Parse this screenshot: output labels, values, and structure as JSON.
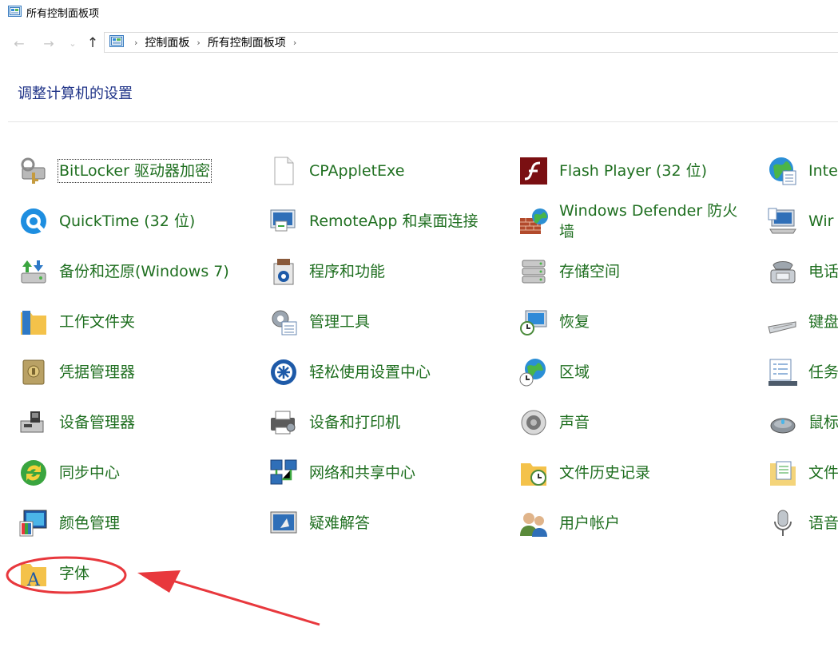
{
  "window": {
    "title": "所有控制面板项",
    "icon": "control-panel-icon"
  },
  "nav": {
    "back_icon": "←",
    "forward_icon": "→",
    "recent_icon": "⌄",
    "up_icon": "↑"
  },
  "breadcrumb": [
    "控制面板",
    "所有控制面板项"
  ],
  "heading": "调整计算机的设置",
  "items": [
    {
      "label": "BitLocker 驱动器加密",
      "icon": "bitlocker-icon"
    },
    {
      "label": "CPAppletExe",
      "icon": "file-icon"
    },
    {
      "label": "Flash Player (32 位)",
      "icon": "flash-icon"
    },
    {
      "label": "Inte",
      "icon": "internet-options-icon"
    },
    {
      "label": "QuickTime (32 位)",
      "icon": "quicktime-icon"
    },
    {
      "label": "RemoteApp 和桌面连接",
      "icon": "remoteapp-icon"
    },
    {
      "label": "Windows Defender 防火墙",
      "icon": "firewall-icon"
    },
    {
      "label": "Wir",
      "icon": "windows-mobility-icon"
    },
    {
      "label": "备份和还原(Windows 7)",
      "icon": "backup-icon"
    },
    {
      "label": "程序和功能",
      "icon": "programs-icon"
    },
    {
      "label": "存储空间",
      "icon": "storage-icon"
    },
    {
      "label": "电话",
      "icon": "phone-icon"
    },
    {
      "label": "工作文件夹",
      "icon": "work-folders-icon"
    },
    {
      "label": "管理工具",
      "icon": "admin-tools-icon"
    },
    {
      "label": "恢复",
      "icon": "recovery-icon"
    },
    {
      "label": "键盘",
      "icon": "keyboard-icon"
    },
    {
      "label": "凭据管理器",
      "icon": "credential-icon"
    },
    {
      "label": "轻松使用设置中心",
      "icon": "ease-of-access-icon"
    },
    {
      "label": "区域",
      "icon": "region-icon"
    },
    {
      "label": "任务",
      "icon": "taskbar-icon"
    },
    {
      "label": "设备管理器",
      "icon": "device-manager-icon"
    },
    {
      "label": "设备和打印机",
      "icon": "printer-icon"
    },
    {
      "label": "声音",
      "icon": "sound-icon"
    },
    {
      "label": "鼠标",
      "icon": "mouse-icon"
    },
    {
      "label": "同步中心",
      "icon": "sync-icon"
    },
    {
      "label": "网络和共享中心",
      "icon": "network-icon"
    },
    {
      "label": "文件历史记录",
      "icon": "file-history-icon"
    },
    {
      "label": "文件",
      "icon": "file-explorer-options-icon"
    },
    {
      "label": "颜色管理",
      "icon": "color-management-icon"
    },
    {
      "label": "疑难解答",
      "icon": "troubleshooting-icon"
    },
    {
      "label": "用户帐户",
      "icon": "user-accounts-icon"
    },
    {
      "label": "语音",
      "icon": "speech-icon"
    },
    {
      "label": "字体",
      "icon": "fonts-icon"
    }
  ],
  "colors": {
    "link": "#1f6f20",
    "heading": "#1e3287",
    "annotation": "#e8383d"
  }
}
